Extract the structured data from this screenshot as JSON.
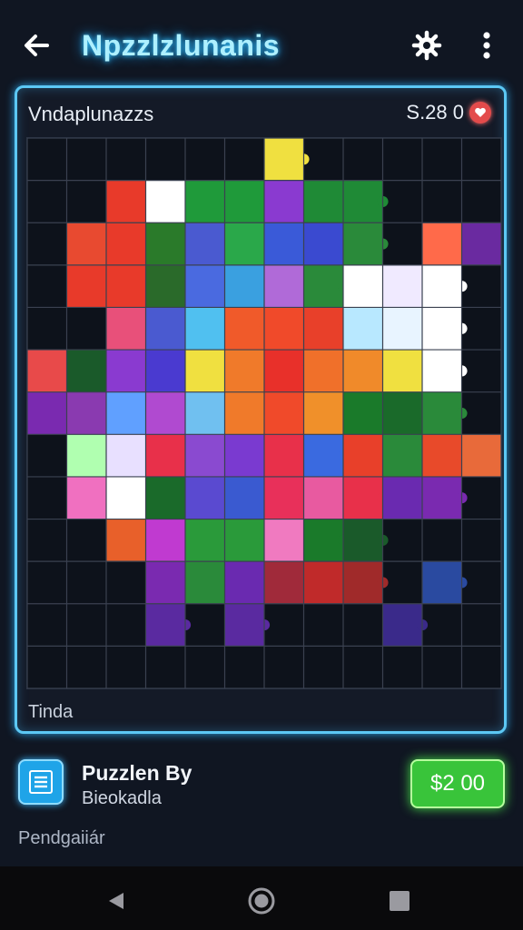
{
  "header": {
    "title": "Npzzlzlunanis",
    "back_icon": "back-arrow-icon",
    "settings_icon": "gear-icon",
    "more_icon": "more-vertical-icon"
  },
  "board": {
    "label": "Vndaplunazzs",
    "score": "S.28 0",
    "heart_icon": "heart-icon",
    "footer_label": "Tinda",
    "grid": {
      "cols": 12,
      "rows": 13,
      "cells": [
        [
          null,
          null,
          null,
          null,
          null,
          null,
          "#f0e040",
          null,
          null,
          null,
          null,
          null
        ],
        [
          null,
          null,
          "#e83a2a",
          "#ffffff",
          "#1f9a3a",
          "#1f9a3a",
          "#8a3ad0",
          "#1f8a36",
          "#1f8a36",
          null,
          null,
          null
        ],
        [
          null,
          "#e84a30",
          "#e83a2a",
          "#2a7a2a",
          "#4a5ad0",
          "#2aa84a",
          "#3a5ad8",
          "#3a4ad0",
          "#2a8a3a",
          null,
          "#ff6a4a",
          "#6a2aa0"
        ],
        [
          null,
          "#e83a2a",
          "#e83a2a",
          "#2a6a2a",
          "#4a6ae0",
          "#3aa0e0",
          "#b06ad8",
          "#2a8a3a",
          "#ffffff",
          "#f0eaff",
          "#ffffff",
          null
        ],
        [
          null,
          null,
          "#e8507a",
          "#4a5ad0",
          "#50c0f0",
          "#f05a2a",
          "#f04a2a",
          "#e8402a",
          "#b8e8ff",
          "#e8f4ff",
          "#ffffff",
          null
        ],
        [
          "#e84a4a",
          "#1a5a2a",
          "#8a3ad0",
          "#4a3ad0",
          "#f0e040",
          "#f07a2a",
          "#e8302a",
          "#f0702a",
          "#f08a2a",
          "#f0e040",
          "#ffffff",
          null
        ],
        [
          "#7a2ab0",
          "#8a3ab0",
          "#60a0ff",
          "#b04ad0",
          "#70c0f0",
          "#f07a2a",
          "#f04a2a",
          "#f0902a",
          "#1a7a2a",
          "#1a6a2a",
          "#2a8a3a",
          null
        ],
        [
          null,
          "#b0ffb0",
          "#e8e0ff",
          "#e8304a",
          "#8a4ad0",
          "#7a3ad0",
          "#e8304a",
          "#3a6ae0",
          "#e8402a",
          "#2a8a3a",
          "#e84a2a",
          "#e86a3a"
        ],
        [
          null,
          "#f070c0",
          "#ffffff",
          "#1a6a2a",
          "#5a4ad0",
          "#3a5ad0",
          "#e8305a",
          "#e85aa0",
          "#e8304a",
          "#6a2ab0",
          "#7a2ab0",
          null
        ],
        [
          null,
          null,
          "#e8602a",
          "#c03ad0",
          "#2a9a3a",
          "#2a9a3a",
          "#f07ac0",
          "#1a7a2a",
          "#1a5a2a",
          null,
          null,
          null
        ],
        [
          null,
          null,
          null,
          "#7a2ab0",
          "#2a8a3a",
          "#6a2ab0",
          "#a02a3a",
          "#c02a2a",
          "#a02a2a",
          null,
          "#2a4aa0",
          null
        ],
        [
          null,
          null,
          null,
          "#5a2aa0",
          null,
          "#5a2aa0",
          null,
          null,
          null,
          "#3a2a8a",
          null,
          null
        ],
        [
          null,
          null,
          null,
          null,
          null,
          null,
          null,
          null,
          null,
          null,
          null,
          null
        ]
      ]
    }
  },
  "list_item": {
    "icon": "list-menu-icon",
    "title": "Puzzlen By",
    "subtitle": "Bieokadla",
    "price_label": "$2 00"
  },
  "pending_label": "Pendgaiiár",
  "navbar": {
    "back_icon": "nav-back-triangle-icon",
    "home_icon": "nav-home-circle-icon",
    "recents_icon": "nav-recents-square-icon"
  }
}
